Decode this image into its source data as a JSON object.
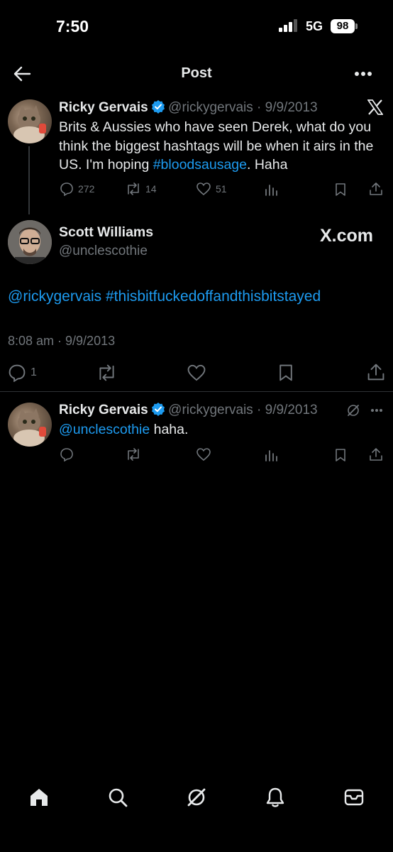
{
  "status_bar": {
    "time": "7:50",
    "network": "5G",
    "battery": "98"
  },
  "header": {
    "title": "Post"
  },
  "tweet1": {
    "name": "Ricky Gervais",
    "handle": "@rickygervais",
    "separator": " · ",
    "date": "9/9/2013",
    "text_before": "Brits & Aussies who have seen Derek, what do you think the biggest hashtags will be when it airs in the US. I'm hoping ",
    "hashtag": "#bloodsausage",
    "text_after": ". Haha",
    "replies": "272",
    "retweets": "14",
    "likes": "51"
  },
  "tweet2": {
    "name": "Scott Williams",
    "handle": "@unclescothie",
    "watermark": "X.com",
    "text": "@rickygervais #thisbitfuckedoffandthisbitstayed",
    "timestamp": "8:08 am · 9/9/2013",
    "replies": "1"
  },
  "tweet3": {
    "name": "Ricky Gervais",
    "handle": "@rickygervais",
    "separator": " · ",
    "date": "9/9/2013",
    "mention": "@unclescothie",
    "text": " haha."
  },
  "colors": {
    "accent": "#1d9bf0",
    "muted": "#71767b",
    "text": "#e7e9ea",
    "background": "#000000"
  }
}
